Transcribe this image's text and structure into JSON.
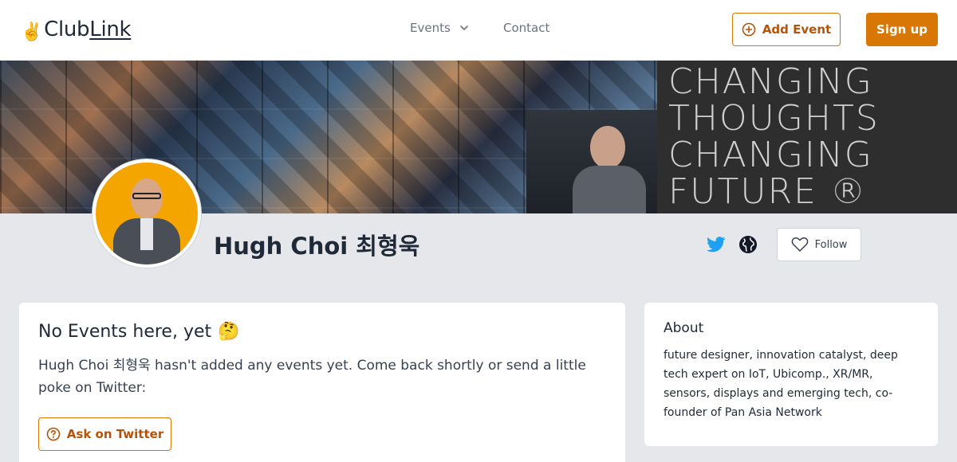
{
  "header": {
    "logo_emoji": "✌️",
    "logo_club": "Club",
    "logo_link": "Link",
    "nav_events": "Events",
    "nav_contact": "Contact",
    "add_event_label": "Add Event",
    "signup_label": "Sign up"
  },
  "banner": {
    "slogan_lines": [
      "CHANGING",
      "THOUGHTS",
      "CHANGING",
      "FUTURE ®"
    ]
  },
  "profile": {
    "name": "Hugh Choi 최형욱",
    "follow_label": "Follow"
  },
  "events_card": {
    "title": "No Events here, yet",
    "title_emoji": "🤔",
    "message": "Hugh Choi 최형욱 hasn't added any events yet. Come back shortly or send a little poke on Twitter:",
    "ask_button_label": "Ask on Twitter"
  },
  "about_card": {
    "heading": "About",
    "text": "future designer, innovation catalyst, deep tech expert on IoT, Ubicomp., XR/MR, sensors, displays and emerging tech, co-founder of Pan Asia Network"
  },
  "colors": {
    "accent": "#d97706",
    "twitter": "#1da1f2"
  }
}
